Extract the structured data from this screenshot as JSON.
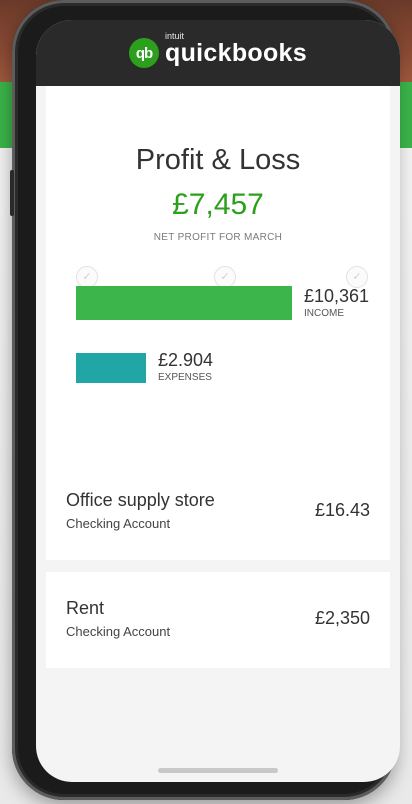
{
  "app": {
    "logo_badge": "qb",
    "logo_small": "intuit",
    "logo_name": "quickbooks",
    "brand_green": "#2ca01c",
    "expense_teal": "#21a6a5"
  },
  "report": {
    "title": "Profit & Loss",
    "net_profit": "£7,457",
    "subtitle": "NET PROFIT FOR MARCH",
    "income_value": "£10,361",
    "income_label": "INCOME",
    "expenses_value": "£2.904",
    "expenses_label": "EXPENSES",
    "tick_icon": "check-icon"
  },
  "transactions": [
    {
      "name": "Office supply store",
      "account": "Checking Account",
      "amount": "£16.43"
    },
    {
      "name": "Rent",
      "account": "Checking Account",
      "amount": "£2,350"
    }
  ]
}
